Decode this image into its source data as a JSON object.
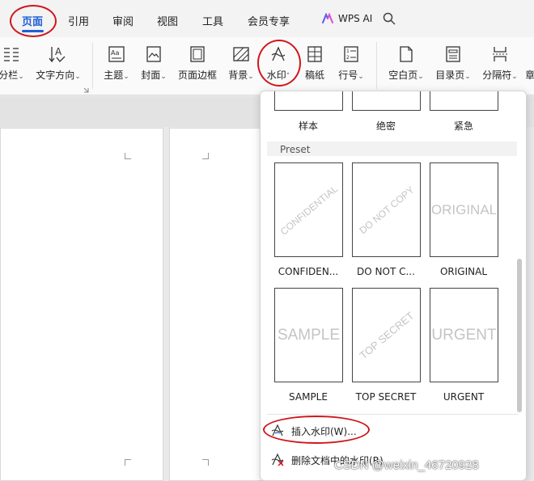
{
  "tabs": [
    {
      "label": "页面",
      "active": true
    },
    {
      "label": "引用"
    },
    {
      "label": "审阅"
    },
    {
      "label": "视图"
    },
    {
      "label": "工具"
    },
    {
      "label": "会员专享"
    }
  ],
  "wps_ai": {
    "label": "WPS AI",
    "icon": "wps-ai-icon"
  },
  "ribbon": [
    {
      "label": "分栏",
      "icon": "columns-icon"
    },
    {
      "label": "文字方向",
      "icon": "text-direction-icon"
    },
    {
      "label": "主题",
      "icon": "theme-icon"
    },
    {
      "label": "封面",
      "icon": "cover-icon"
    },
    {
      "label": "页面边框",
      "icon": "page-border-icon"
    },
    {
      "label": "背景",
      "icon": "background-icon"
    },
    {
      "label": "水印",
      "icon": "watermark-icon"
    },
    {
      "label": "稿纸",
      "icon": "manuscript-icon"
    },
    {
      "label": "行号",
      "icon": "line-number-icon"
    },
    {
      "label": "空白页",
      "icon": "blank-page-icon"
    },
    {
      "label": "目录页",
      "icon": "toc-page-icon"
    },
    {
      "label": "分隔符",
      "icon": "separator-icon"
    },
    {
      "label": "章",
      "icon": "chapter-icon"
    }
  ],
  "watermark_panel": {
    "top_row": [
      "样本",
      "绝密",
      "紧急"
    ],
    "section_title": "Preset",
    "presets": [
      {
        "label": "CONFIDEN...",
        "text": "CONFIDENTIAL",
        "style": "diagonal"
      },
      {
        "label": "DO NOT C...",
        "text": "DO NOT COPY",
        "style": "diagonal"
      },
      {
        "label": "ORIGINAL",
        "text": "ORIGINAL",
        "style": "horizontal"
      },
      {
        "label": "SAMPLE",
        "text": "SAMPLE",
        "style": "horizontal"
      },
      {
        "label": "TOP SECRET",
        "text": "TOP SECRET",
        "style": "diagonal"
      },
      {
        "label": "URGENT",
        "text": "URGENT",
        "style": "horizontal"
      }
    ],
    "insert_label": "插入水印(W)...",
    "delete_label": "删除文档中的水印(R)"
  },
  "credit": "CSDN @weixin_46720928",
  "colors": {
    "accent": "#1d5fd6",
    "annotation": "#d0161b"
  }
}
